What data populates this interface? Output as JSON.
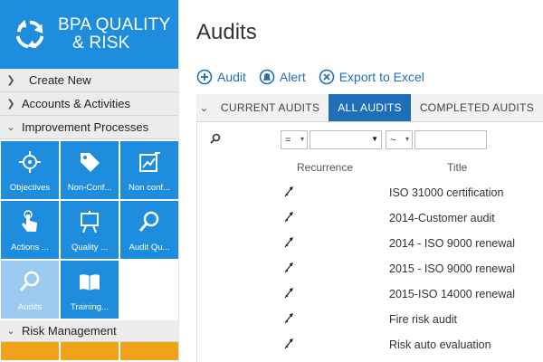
{
  "brand": {
    "line1": "BPA QUALITY",
    "line2": "& RISK"
  },
  "nav": {
    "create_new": "Create New",
    "accounts": "Accounts & Activities",
    "improvement": "Improvement Processes",
    "risk": "Risk Management"
  },
  "tiles": [
    {
      "label": "Objectives",
      "icon": "target-icon"
    },
    {
      "label": "Non-Conf...",
      "icon": "tag-icon"
    },
    {
      "label": "Non conf...",
      "icon": "edit-chart-icon"
    },
    {
      "label": "Actions ...",
      "icon": "hand-pointer-icon"
    },
    {
      "label": "Quality ...",
      "icon": "easel-icon"
    },
    {
      "label": "Audit Qu...",
      "icon": "magnifier-icon"
    },
    {
      "label": "Audits",
      "icon": "magnifier-icon",
      "selected": true
    },
    {
      "label": "Training...",
      "icon": "book-icon"
    }
  ],
  "page": {
    "title": "Audits"
  },
  "actions": {
    "audit": "Audit",
    "alert": "Alert",
    "export": "Export to Excel"
  },
  "tabs": [
    "CURRENT AUDITS",
    "ALL AUDITS",
    "COMPLETED AUDITS"
  ],
  "active_tab": "ALL AUDITS",
  "filters": {
    "operator1": "=",
    "operator2": "~",
    "value1": "",
    "value2": ""
  },
  "columns": {
    "recurrence": "Recurrence",
    "title": "Title"
  },
  "rows": [
    {
      "title": "ISO 31000 certification"
    },
    {
      "title": "2014-Customer audit"
    },
    {
      "title": "2014 - ISO 9000 renewal"
    },
    {
      "title": "2015 - ISO 9000 renewal"
    },
    {
      "title": "2015-ISO 14000 renewal"
    },
    {
      "title": "Fire risk audit"
    },
    {
      "title": "Risk auto evaluation"
    }
  ],
  "colors": {
    "brand_blue": "#1f8ddd",
    "tab_active": "#1f6fb8",
    "tile_selected": "#9cc9ef",
    "risk_orange": "#f0a31a"
  }
}
